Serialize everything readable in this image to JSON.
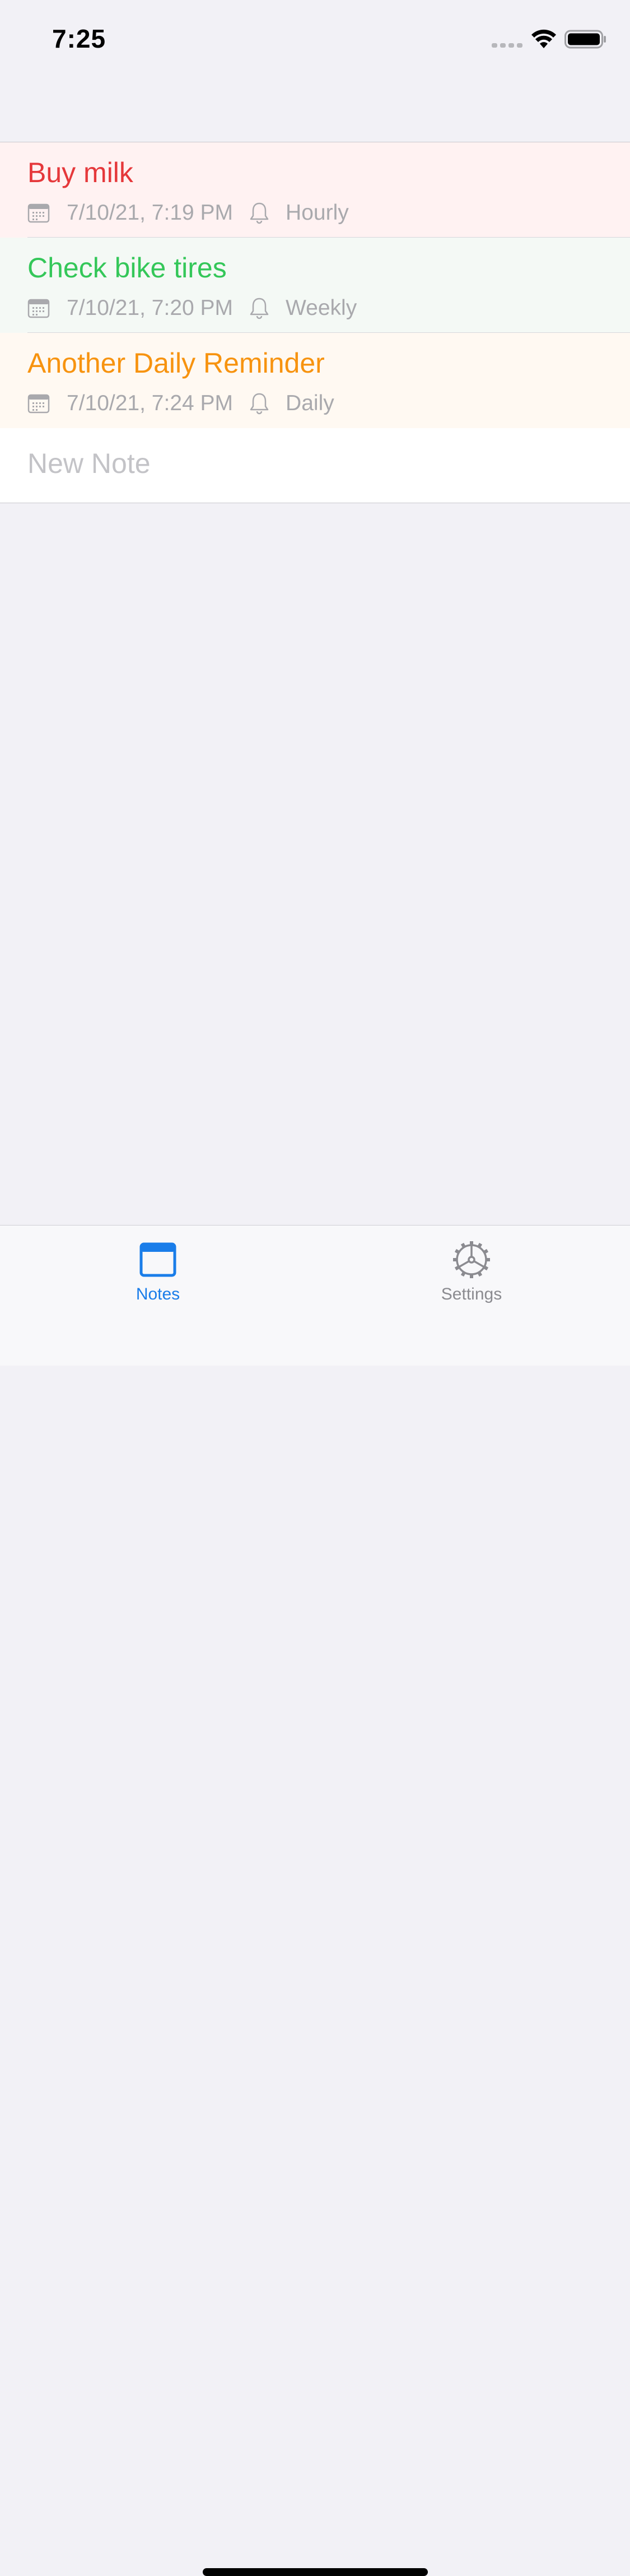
{
  "status_bar": {
    "time": "7:25"
  },
  "notes": [
    {
      "title": "Buy milk",
      "date": "7/10/21, 7:19 PM",
      "repeat": "Hourly",
      "color": "#e5383b",
      "background": "#fff2f2"
    },
    {
      "title": "Check bike tires",
      "date": "7/10/21, 7:20 PM",
      "repeat": "Weekly",
      "color": "#34c759",
      "background": "#f4f9f5"
    },
    {
      "title": "Another Daily Reminder",
      "date": "7/10/21, 7:24 PM",
      "repeat": "Daily",
      "color": "#f7930f",
      "background": "#fff9f2"
    }
  ],
  "new_note": {
    "placeholder": "New Note"
  },
  "tab_bar": {
    "tabs": [
      {
        "label": "Notes",
        "icon": "notes-icon",
        "selected": true
      },
      {
        "label": "Settings",
        "icon": "gear-icon",
        "selected": false
      }
    ]
  },
  "colors": {
    "accent": "#1a7de9",
    "meta_text": "#a9a9ad",
    "background": "#f2f1f6"
  }
}
